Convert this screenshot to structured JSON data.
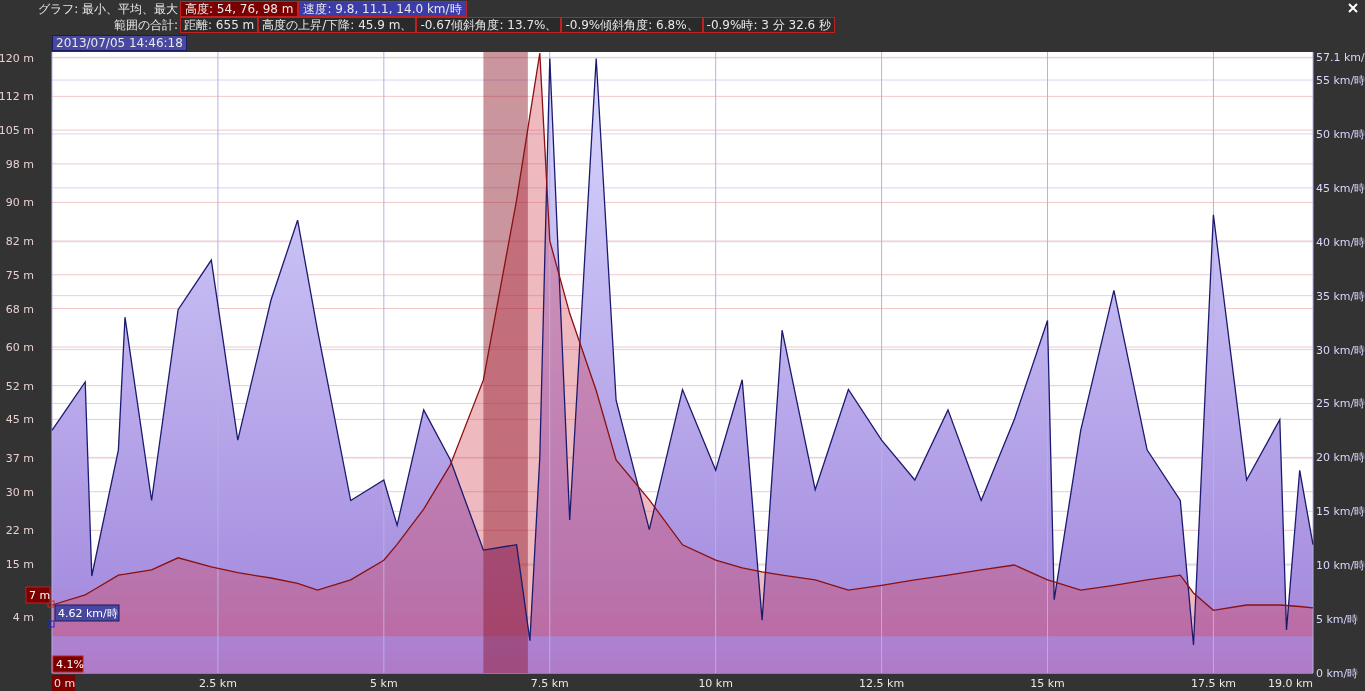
{
  "header": {
    "graph_label": "グラフ: 最小、平均、最大",
    "graph_stats": [
      {
        "text": "高度: 54, 76, 98 m",
        "color": "#7a0000"
      },
      {
        "text": "速度: 9.8, 11.1, 14.0 km/時",
        "color": "#3c3ca8"
      }
    ],
    "range_label": "範囲の合計:",
    "range_stats": [
      "距離: 655 m",
      "高度の上昇/下降: 45.9 m、",
      "-0.67傾斜角度: 13.7%、",
      "-0.9%傾斜角度: 6.8%、",
      "-0.9%時: 3 分 32.6 秒"
    ],
    "timestamp": "2013/07/05 14:46:18"
  },
  "cursor": {
    "elevation": "7 m",
    "speed": "4.62 km/時",
    "grade": "4.1%"
  },
  "chart_data": {
    "type": "area",
    "x": [
      0,
      0.5,
      0.6,
      1.0,
      1.1,
      1.5,
      1.9,
      2.4,
      2.8,
      3.3,
      3.7,
      4.0,
      4.5,
      5.0,
      5.2,
      5.6,
      6.0,
      6.5,
      7.0,
      7.2,
      7.35,
      7.5,
      7.8,
      8.2,
      8.5,
      9.0,
      9.5,
      10.0,
      10.4,
      10.7,
      11.0,
      11.5,
      12.0,
      12.5,
      13.0,
      13.5,
      14.0,
      14.5,
      15.0,
      15.1,
      15.5,
      16.0,
      16.5,
      17.0,
      17.2,
      17.5,
      18.0,
      18.5,
      18.6,
      18.8,
      19.0
    ],
    "series": [
      {
        "color": "#1a1a6e",
        "values": [
          22.5,
          27,
          9,
          20.7,
          33,
          16,
          33.7,
          38.3,
          21.6,
          34.6,
          42,
          31.8,
          16,
          17.9,
          13.7,
          24.4,
          19.8,
          11.4,
          11.9,
          3,
          20,
          57,
          14.2,
          57,
          25.3,
          13.3,
          26.3,
          18.8,
          27.2,
          4.9,
          31.8,
          17,
          26.3,
          21.6,
          17.9,
          24.4,
          16,
          23.5,
          32.7,
          6.8,
          22.5,
          35.5,
          20.7,
          16,
          2.6,
          42.5,
          17.9,
          23.5,
          4,
          18.8,
          11.9
        ]
      },
      {
        "color": "#8b1010",
        "axis": "y2",
        "values": [
          6.5,
          8.6,
          9.4,
          12.7,
          12.9,
          13.8,
          16.3,
          14.4,
          13.2,
          12.1,
          11,
          9.6,
          11.7,
          15.8,
          19.1,
          26.4,
          35.5,
          53.2,
          90.5,
          108,
          121,
          82,
          67,
          51,
          36.6,
          28.3,
          19,
          15.8,
          14.2,
          13.4,
          12.7,
          11.7,
          9.6,
          10.6,
          11.7,
          12.7,
          13.8,
          14.8,
          11.7,
          11.3,
          9.6,
          10.6,
          11.7,
          12.7,
          9,
          5.4,
          6.5,
          6.5,
          6.4,
          6.2,
          5.9
        ]
      }
    ],
    "xlim": [
      0,
      19
    ],
    "xticks": [
      {
        "value": 0,
        "label": "0 m"
      },
      {
        "value": 2.5,
        "label": "2.5 km"
      },
      {
        "value": 5,
        "label": "5 km"
      },
      {
        "value": 7.5,
        "label": "7.5 km"
      },
      {
        "value": 10,
        "label": "10 km"
      },
      {
        "value": 12.5,
        "label": "12.5 km"
      },
      {
        "value": 15,
        "label": "15 km"
      },
      {
        "value": 17.5,
        "label": "17.5 km"
      },
      {
        "value": 19,
        "label": "19.0 km"
      }
    ],
    "ylim": [
      0,
      57.6
    ],
    "yticks": [
      {
        "value": 57.1,
        "label": "57.1 km/"
      },
      {
        "value": 55,
        "label": "55 km/時"
      },
      {
        "value": 50,
        "label": "50 km/時"
      },
      {
        "value": 45,
        "label": "45 km/時"
      },
      {
        "value": 40,
        "label": "40 km/時"
      },
      {
        "value": 35,
        "label": "35 km/時"
      },
      {
        "value": 30,
        "label": "30 km/時"
      },
      {
        "value": 25,
        "label": "25 km/時"
      },
      {
        "value": 20,
        "label": "20 km/時"
      },
      {
        "value": 15,
        "label": "15 km/時"
      },
      {
        "value": 10,
        "label": "10 km/時"
      },
      {
        "value": 5,
        "label": "5 km/時"
      },
      {
        "value": 0,
        "label": "0 km/時"
      }
    ],
    "y2lim": [
      -7.6,
      121.2
    ],
    "y2ticks": [
      {
        "value": 120,
        "label": "120 m"
      },
      {
        "value": 112,
        "label": "112 m"
      },
      {
        "value": 105,
        "label": "105 m"
      },
      {
        "value": 98,
        "label": "98 m"
      },
      {
        "value": 90,
        "label": "90 m"
      },
      {
        "value": 82,
        "label": "82 m"
      },
      {
        "value": 75,
        "label": "75 m"
      },
      {
        "value": 68,
        "label": "68 m"
      },
      {
        "value": 60,
        "label": "60 m"
      },
      {
        "value": 52,
        "label": "52 m"
      },
      {
        "value": 45,
        "label": "45 m"
      },
      {
        "value": 37,
        "label": "37 m"
      },
      {
        "value": 30,
        "label": "30 m"
      },
      {
        "value": 22,
        "label": "22 m"
      },
      {
        "value": 15,
        "label": "15 m"
      },
      {
        "value": 4,
        "label": "4 m"
      }
    ],
    "grid": true,
    "bands": [
      {
        "axis": "x",
        "from": 6.5,
        "to": 7.17
      }
    ]
  }
}
